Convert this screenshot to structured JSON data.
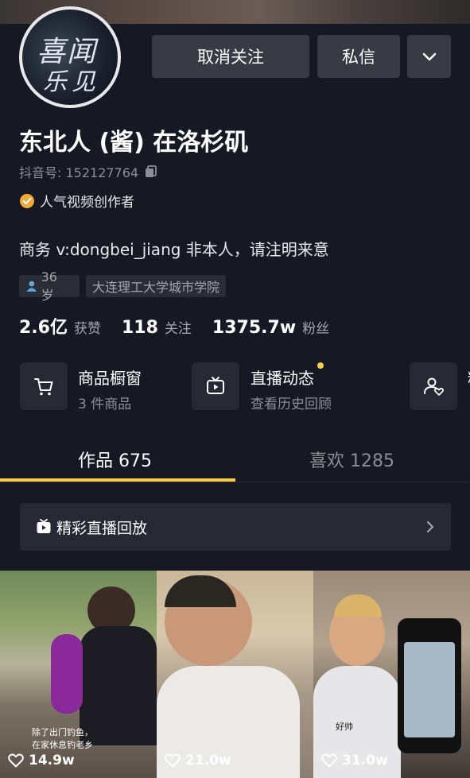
{
  "header": {
    "avatar_text_line1": "喜闻",
    "avatar_text_line2": "乐见"
  },
  "actions": {
    "unfollow_label": "取消关注",
    "message_label": "私信",
    "more_icon": "chevron-down-icon"
  },
  "profile": {
    "name": "东北人 (酱) 在洛杉矶",
    "id_label": "抖音号: 152127764",
    "certification": "人气视频创作者",
    "bio": "商务 v:dongbei_jiang 非本人，请注明来意",
    "tags": [
      {
        "label": "36 岁",
        "icon": "person-icon"
      },
      {
        "label": "大连理工大学城市学院"
      }
    ]
  },
  "stats": [
    {
      "value": "2.6亿",
      "label": "获赞"
    },
    {
      "value": "118",
      "label": "关注"
    },
    {
      "value": "1375.7w",
      "label": "粉丝"
    }
  ],
  "features": [
    {
      "title": "商品橱窗",
      "subtitle": "3 件商品",
      "icon": "cart-icon"
    },
    {
      "title": "直播动态",
      "subtitle": "查看历史回顾",
      "icon": "tv-icon"
    },
    {
      "title": "粉",
      "icon": "group-icon"
    }
  ],
  "tabs": [
    {
      "label": "作品 675",
      "active": true
    },
    {
      "label": "喜欢 1285",
      "active": false
    }
  ],
  "replay": {
    "label": "精彩直播回放"
  },
  "videos": [
    {
      "likes": "14.9w",
      "caption": "除了出门钓鱼，\n在家休息钓老乡"
    },
    {
      "likes": "21.0w"
    },
    {
      "likes": "31.0w",
      "caption": "好帅"
    }
  ],
  "colors": {
    "background": "#161823",
    "accent": "#facd4c",
    "button": "#383b44",
    "certification": "#f0a93c"
  }
}
